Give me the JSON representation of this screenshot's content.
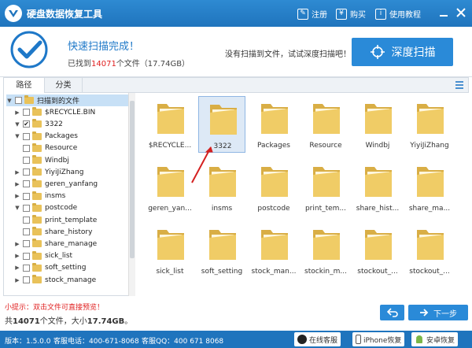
{
  "app": {
    "title": "硬盘数据恢复工具"
  },
  "topbar": {
    "register": "注册",
    "buy": "购买",
    "tutorial": "使用教程"
  },
  "header": {
    "title": "快速扫描完成！",
    "found_prefix": "已找到",
    "found_count": "14071",
    "found_suffix": "个文件（17.74GB）",
    "hint": "没有扫描到文件，试试深度扫描吧！",
    "deep_scan": "深度扫描"
  },
  "tabs": {
    "path": "路径",
    "category": "分类"
  },
  "tree": [
    {
      "label": "扫描到的文件",
      "level": 0,
      "arrow": "▼",
      "checked": false,
      "selected": true
    },
    {
      "label": "$RECYCLE.BIN",
      "level": 1,
      "arrow": "▶",
      "checked": false
    },
    {
      "label": "3322",
      "level": 1,
      "arrow": "▼",
      "checked": true
    },
    {
      "label": "Packages",
      "level": 1,
      "arrow": "▼",
      "checked": false
    },
    {
      "label": "Resource",
      "level": 1,
      "arrow": "",
      "checked": false
    },
    {
      "label": "Windbj",
      "level": 1,
      "arrow": "",
      "checked": false
    },
    {
      "label": "YiyiJiZhang",
      "level": 1,
      "arrow": "▶",
      "checked": false
    },
    {
      "label": "geren_yanfang",
      "level": 1,
      "arrow": "▶",
      "checked": false
    },
    {
      "label": "insms",
      "level": 1,
      "arrow": "▶",
      "checked": false
    },
    {
      "label": "postcode",
      "level": 1,
      "arrow": "▼",
      "checked": false
    },
    {
      "label": "print_template",
      "level": 1,
      "arrow": "",
      "checked": false
    },
    {
      "label": "share_history",
      "level": 1,
      "arrow": "",
      "checked": false
    },
    {
      "label": "share_manage",
      "level": 1,
      "arrow": "▶",
      "checked": false
    },
    {
      "label": "sick_list",
      "level": 1,
      "arrow": "▶",
      "checked": false
    },
    {
      "label": "soft_setting",
      "level": 1,
      "arrow": "▶",
      "checked": false
    },
    {
      "label": "stock_manage",
      "level": 1,
      "arrow": "▶",
      "checked": false
    }
  ],
  "files": [
    {
      "name": "$RECYCLE..."
    },
    {
      "name": "3322",
      "selected": true
    },
    {
      "name": "Packages"
    },
    {
      "name": "Resource"
    },
    {
      "name": "Windbj"
    },
    {
      "name": "YiyiJiZhang"
    },
    {
      "name": "geren_yan..."
    },
    {
      "name": "insms"
    },
    {
      "name": "postcode"
    },
    {
      "name": "print_tem..."
    },
    {
      "name": "share_hist..."
    },
    {
      "name": "share_ma..."
    },
    {
      "name": "sick_list"
    },
    {
      "name": "soft_setting"
    },
    {
      "name": "stock_man..."
    },
    {
      "name": "stockin_m..."
    },
    {
      "name": "stockout_..."
    },
    {
      "name": "stockout_..."
    }
  ],
  "bottom": {
    "tip": "小提示：双击文件可直接预览！",
    "total_prefix": "共",
    "total_count": "14071",
    "total_mid": "个文件，大小",
    "total_size": "17.74GB",
    "total_suffix": "。",
    "next": "下一步"
  },
  "status": {
    "version": "版本：1.5.0.0",
    "phone": "客服电话：400-671-8068",
    "qq": "客服QQ：400 671 8068",
    "online": "在线客服",
    "iphone": "iPhone恢复",
    "android": "安卓恢复"
  },
  "colors": {
    "accent": "#1f74bd",
    "button": "#2a8ad8",
    "highlight": "#e02020",
    "folder": "#f0cc66"
  }
}
